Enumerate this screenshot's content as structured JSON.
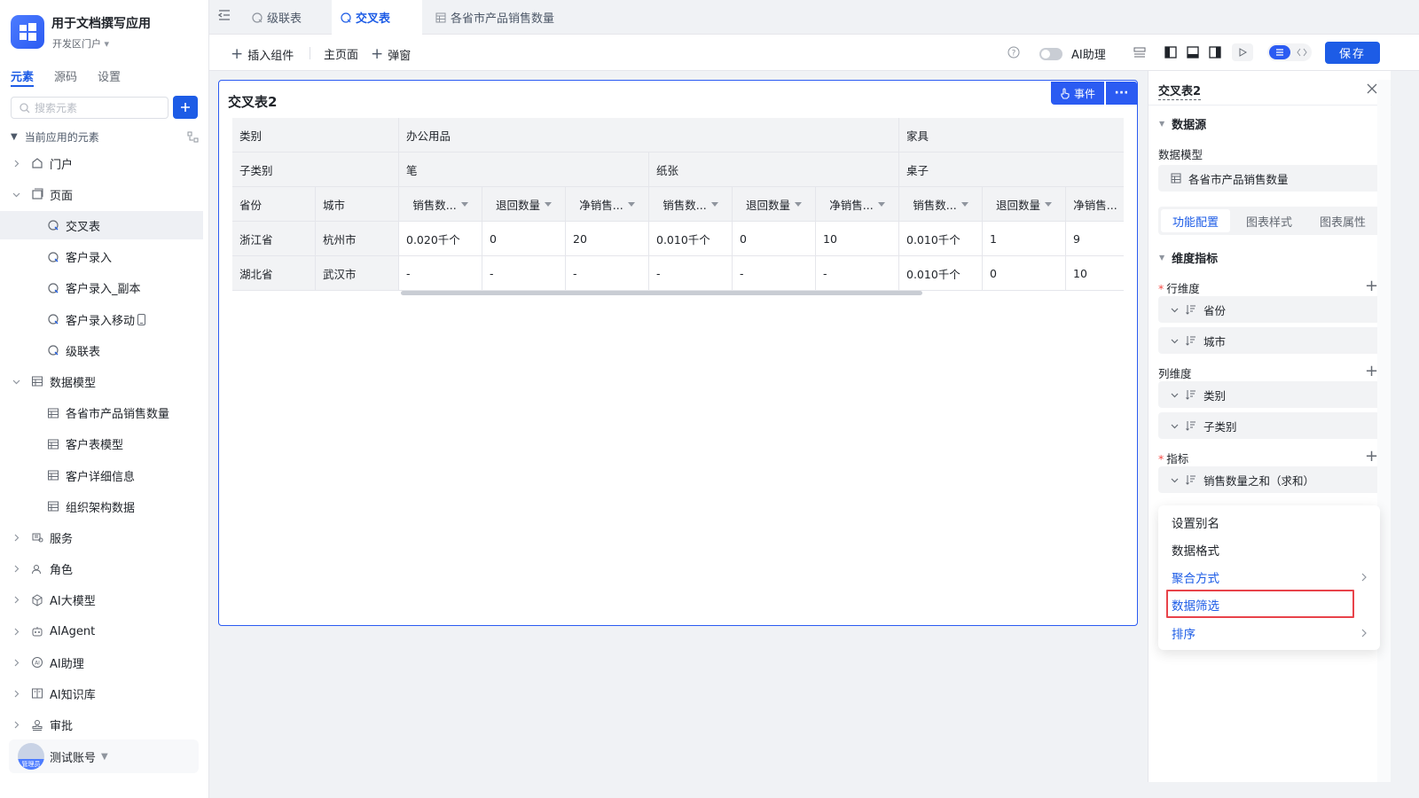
{
  "app": {
    "title": "用于文档撰写应用",
    "subtitle": "开发区门户"
  },
  "sidebar": {
    "tabs": [
      "元素",
      "源码",
      "设置"
    ],
    "search_placeholder": "搜索元素",
    "tree_header": "当前应用的元素",
    "items": [
      {
        "label": "门户",
        "icon": "home-icon",
        "level": 0,
        "caret": "right"
      },
      {
        "label": "页面",
        "icon": "pages-icon",
        "level": 0,
        "caret": "down"
      },
      {
        "label": "交叉表",
        "icon": "page-icon",
        "level": 1,
        "selected": true
      },
      {
        "label": "客户录入",
        "icon": "page-icon",
        "level": 1
      },
      {
        "label": "客户录入_副本",
        "icon": "page-icon",
        "level": 1
      },
      {
        "label": "客户录入移动",
        "icon": "page-icon",
        "level": 1,
        "mobile": true
      },
      {
        "label": "级联表",
        "icon": "page-icon",
        "level": 1
      },
      {
        "label": "数据模型",
        "icon": "table-icon",
        "level": 0,
        "caret": "down"
      },
      {
        "label": "各省市产品销售数量",
        "icon": "table-icon",
        "level": 1
      },
      {
        "label": "客户表模型",
        "icon": "table-icon",
        "level": 1
      },
      {
        "label": "客户详细信息",
        "icon": "table-icon",
        "level": 1
      },
      {
        "label": "组织架构数据",
        "icon": "table-icon",
        "level": 1
      },
      {
        "label": "服务",
        "icon": "service-icon",
        "level": 0,
        "caret": "right"
      },
      {
        "label": "角色",
        "icon": "role-icon",
        "level": 0,
        "caret": "right"
      },
      {
        "label": "AI大模型",
        "icon": "model-icon",
        "level": 0,
        "caret": "right"
      },
      {
        "label": "AIAgent",
        "icon": "robot-icon",
        "level": 0,
        "caret": "right"
      },
      {
        "label": "AI助理",
        "icon": "ai-icon",
        "level": 0,
        "caret": "right"
      },
      {
        "label": "AI知识库",
        "icon": "book-icon",
        "level": 0,
        "caret": "right"
      },
      {
        "label": "审批",
        "icon": "stamp-icon",
        "level": 0,
        "caret": "right"
      }
    ],
    "account": {
      "name": "测试账号",
      "role": "管理员"
    }
  },
  "tabs": [
    "级联表",
    "交叉表",
    "各省市产品销售数量"
  ],
  "toolbar": {
    "insert": "插入组件",
    "home": "主页面",
    "popup": "弹窗",
    "ai": "AI助理",
    "save": "保存"
  },
  "canvas": {
    "title": "交叉表2",
    "event": "事件",
    "more": "···",
    "rows": [
      [
        "类别",
        "",
        "办公用品",
        "",
        "",
        "",
        "",
        "",
        "家具",
        "",
        ""
      ],
      [
        "子类别",
        "",
        "笔",
        "",
        "",
        "纸张",
        "",
        "",
        "桌子",
        "",
        ""
      ],
      [
        "省份",
        "城市",
        "销售数...",
        "退回数量",
        "净销售...",
        "销售数...",
        "退回数量",
        "净销售...",
        "销售数...",
        "退回数量",
        "净销售..."
      ],
      [
        "浙江省",
        "杭州市",
        "0.020千个",
        "0",
        "20",
        "0.010千个",
        "0",
        "10",
        "0.010千个",
        "1",
        "9"
      ],
      [
        "湖北省",
        "武汉市",
        "-",
        "-",
        "-",
        "-",
        "-",
        "-",
        "0.010千个",
        "0",
        "10"
      ]
    ]
  },
  "panel": {
    "title": "交叉表2",
    "datasource": "数据源",
    "model_label": "数据模型",
    "model_value": "各省市产品销售数量",
    "tabs": [
      "功能配置",
      "图表样式",
      "图表属性"
    ],
    "dims": "维度指标",
    "row_dim": "行维度",
    "row_items": [
      "省份",
      "城市"
    ],
    "col_dim": "列维度",
    "col_items": [
      "类别",
      "子类别"
    ],
    "metric": "指标",
    "metric_items": [
      "销售数量之和（求和）"
    ]
  },
  "menu": [
    {
      "label": "设置别名"
    },
    {
      "label": "数据格式"
    },
    {
      "label": "聚合方式",
      "submenu": true
    },
    {
      "label": "数据筛选",
      "highlight": true
    },
    {
      "label": "排序",
      "submenu": true
    }
  ],
  "colors": {
    "accent": "#1d5ce6",
    "highlight": "#e8434a"
  }
}
